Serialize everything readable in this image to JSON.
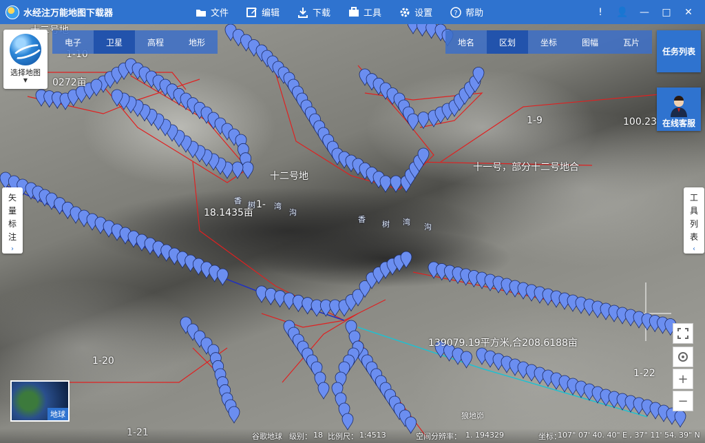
{
  "app": {
    "title": "水经注万能地图下载器"
  },
  "menu": [
    {
      "label": "文件",
      "icon": "folder-icon"
    },
    {
      "label": "编辑",
      "icon": "edit-icon"
    },
    {
      "label": "下载",
      "icon": "download-icon"
    },
    {
      "label": "工具",
      "icon": "toolbox-icon"
    },
    {
      "label": "设置",
      "icon": "gear-icon"
    },
    {
      "label": "帮助",
      "icon": "help-icon"
    }
  ],
  "window_controls": {
    "info": "!",
    "user": "👤",
    "minimize": "—",
    "maximize": "□",
    "close": "✕"
  },
  "map_chooser": {
    "label": "选择地图"
  },
  "map_types": {
    "items": [
      "电子",
      "卫星",
      "高程",
      "地形"
    ],
    "active": "卫星"
  },
  "layers": {
    "items": [
      "地名",
      "区划",
      "坐标",
      "图幅",
      "瓦片"
    ],
    "active": "区划"
  },
  "task_list": {
    "label": "任务列表"
  },
  "online_service": {
    "label": "在线客服"
  },
  "vector_annotation": {
    "chars": [
      "矢",
      "量",
      "标",
      "注"
    ]
  },
  "tools_list": {
    "chars": [
      "工",
      "具",
      "列",
      "表"
    ]
  },
  "map_labels": {
    "l1": "十二号地",
    "l2": "1-10",
    "l3": "0272亩",
    "l4": "1-9",
    "l5": "100.23",
    "l6": "十二号地",
    "l7": "十一号，部分十二号地合",
    "l8": "18.1435亩",
    "l9": "1-",
    "l10": "139079.19平方米,合208.6188亩",
    "l11": "1-20",
    "l12": "1-22",
    "l13": "1-21",
    "l14": "狼地峁"
  },
  "river_labels": {
    "r1": [
      "香",
      "树",
      "湾",
      "沟"
    ],
    "r2": [
      "香",
      "树",
      "湾",
      "沟"
    ]
  },
  "earth_thumb": {
    "label": "地球"
  },
  "status": {
    "source": "谷歌地球",
    "level_label": "级别：",
    "level": "18",
    "scale_label": "比例尺：",
    "scale": "1:4513",
    "resolution_label": "空间分辨率：",
    "resolution": "1. 194329",
    "coord_label": "坐标：",
    "coord": "107° 07' 40. 40\" E , 37° 11' 54. 39\" N"
  },
  "colors": {
    "accent": "#2f73cf",
    "pin": "#6b8ef0",
    "boundary": "#e02020"
  }
}
